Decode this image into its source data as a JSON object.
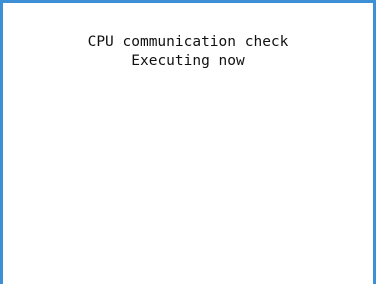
{
  "dialog": {
    "line1": "CPU communication check",
    "line2": "Executing now"
  },
  "colors": {
    "frame": "#3d8fd6",
    "background": "#ffffff",
    "text": "#111111"
  }
}
